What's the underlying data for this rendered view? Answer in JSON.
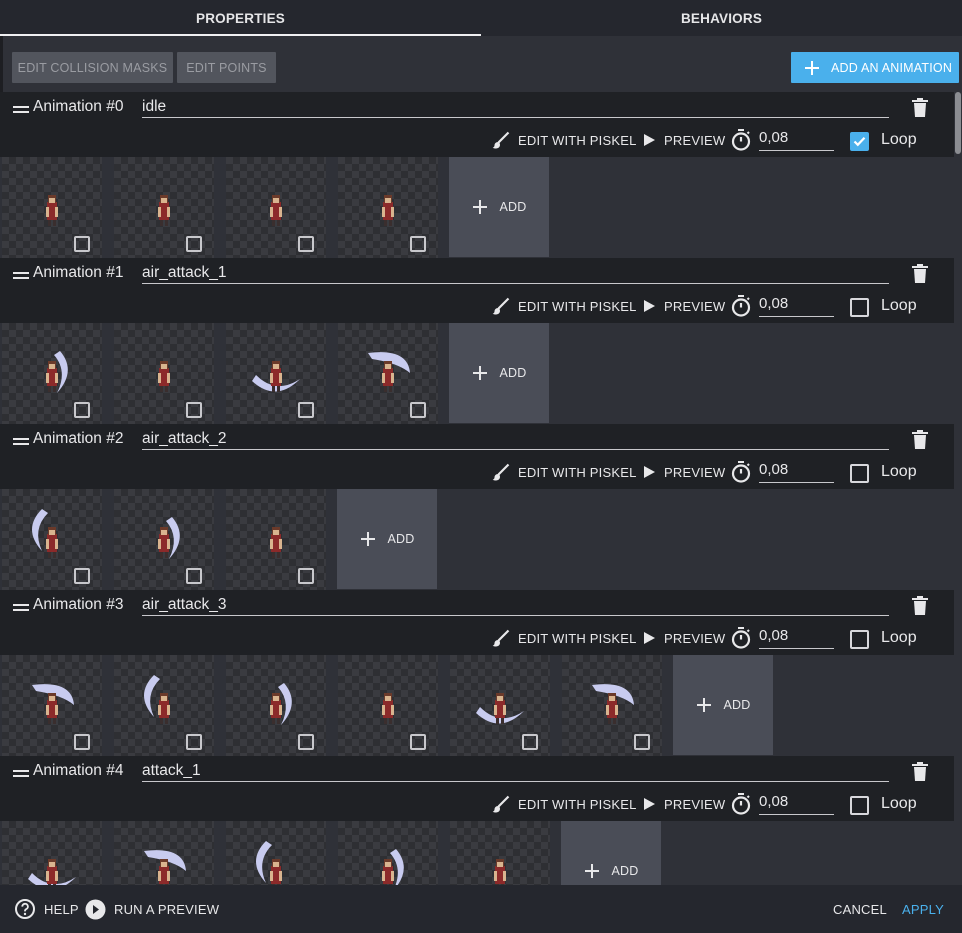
{
  "tabs": [
    {
      "label": "PROPERTIES",
      "active": true
    },
    {
      "label": "BEHAVIORS",
      "active": false
    }
  ],
  "toolbar": {
    "edit_collision": "EDIT COLLISION MASKS",
    "edit_points": "EDIT POINTS",
    "add_animation": "ADD AN ANIMATION"
  },
  "row_labels": {
    "edit_piskel": "EDIT WITH PISKEL",
    "preview": "PREVIEW",
    "loop": "Loop",
    "add": "ADD"
  },
  "animations": [
    {
      "label": "Animation #0",
      "name": "idle",
      "duration": "0,08",
      "loop": true,
      "frame_count": 4
    },
    {
      "label": "Animation #1",
      "name": "air_attack_1",
      "duration": "0,08",
      "loop": false,
      "frame_count": 4
    },
    {
      "label": "Animation #2",
      "name": "air_attack_2",
      "duration": "0,08",
      "loop": false,
      "frame_count": 3
    },
    {
      "label": "Animation #3",
      "name": "air_attack_3",
      "duration": "0,08",
      "loop": false,
      "frame_count": 6
    },
    {
      "label": "Animation #4",
      "name": "attack_1",
      "duration": "0,08",
      "loop": false,
      "frame_count": 5
    }
  ],
  "footer": {
    "help": "HELP",
    "run_preview": "RUN A PREVIEW",
    "cancel": "CANCEL",
    "apply": "APPLY"
  },
  "colors": {
    "accent": "#4ab0ec",
    "background": "#2f3138",
    "header_row": "#1f2125"
  }
}
